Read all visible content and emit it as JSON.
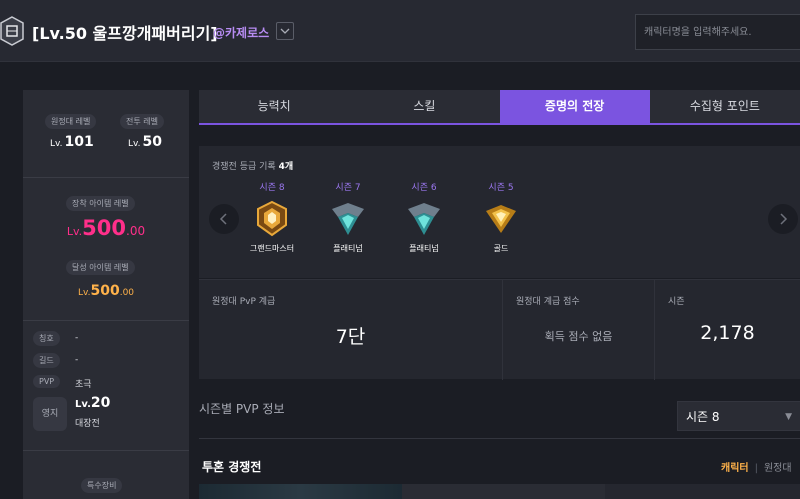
{
  "header": {
    "title": "[Lv.50 울프깡개패버리기]",
    "server": "@카제로스",
    "search_placeholder": "캐릭터명을 입력해주세요."
  },
  "left": {
    "expedition_label": "원정대 레벨",
    "expedition_lv_prefix": "Lv.",
    "expedition_lv": "101",
    "combat_label": "전투 레벨",
    "combat_lv_prefix": "Lv.",
    "combat_lv": "50",
    "equip_label": "장착 아이템 레벨",
    "equip_prefix": "Lv.",
    "equip_int": "500",
    "equip_dec": ".00",
    "achieved_label": "달성 아이템 레벨",
    "achieved_prefix": "Lv.",
    "achieved_int": "500",
    "achieved_dec": ".00",
    "title_label": "칭호",
    "title_value": "-",
    "guild_label": "길드",
    "guild_value": "-",
    "pvp_label": "PVP",
    "pvp_value": "초극",
    "estate_label": "영지",
    "estate_lv_prefix": "Lv.",
    "estate_lv": "20",
    "estate_name": "대장전",
    "special_label": "특수장비"
  },
  "tabs": [
    "능력치",
    "스킬",
    "증명의 전장",
    "수집형 포인트"
  ],
  "active_tab": 2,
  "rank": {
    "title": "경쟁전 등급 기록",
    "count": "4개",
    "seasons": [
      {
        "season": "시즌 8",
        "tier": "그랜드마스터",
        "emblem": "grandmaster-emblem",
        "color": "#e8a83a"
      },
      {
        "season": "시즌 7",
        "tier": "플래티넘",
        "emblem": "platinum-emblem",
        "color": "#4fd1c5"
      },
      {
        "season": "시즌 6",
        "tier": "플래티넘",
        "emblem": "platinum-emblem",
        "color": "#4fd1c5"
      },
      {
        "season": "시즌 5",
        "tier": "골드",
        "emblem": "gold-emblem",
        "color": "#f2c14a"
      }
    ]
  },
  "stats": {
    "pvp_grade_label": "원정대 PvP 계급",
    "pvp_grade_value": "7단",
    "grade_score_label": "원정대 계급 점수",
    "grade_score_value": "획득 점수 없음",
    "season_label": "시즌",
    "season_value": "2,178"
  },
  "season_pvp": {
    "heading": "시즌별 PVP 정보",
    "selected": "시즌 8"
  },
  "duo": {
    "title": "투혼 경쟁전",
    "tab_on": "캐릭터",
    "tab_off": "원정대"
  },
  "colors": {
    "accent": "#7b54e0",
    "pink": "#ff2f8a",
    "orange": "#ffb24a",
    "purple_text": "#9b77f0"
  }
}
